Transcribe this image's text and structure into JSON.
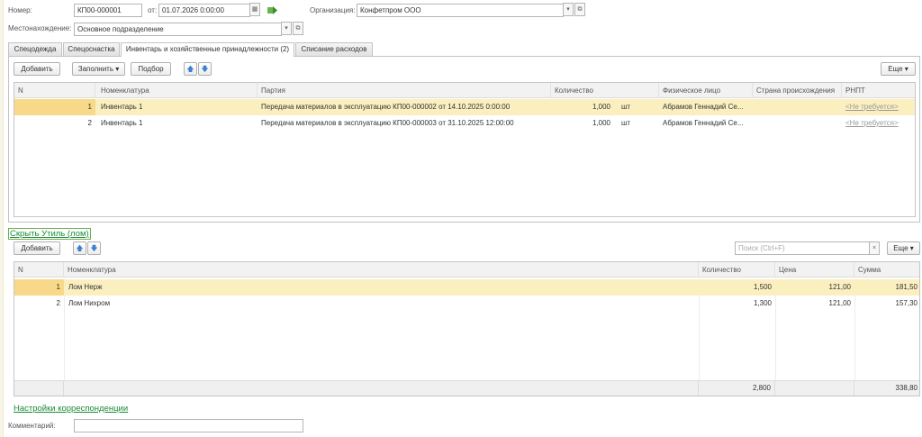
{
  "header": {
    "number_label": "Номер:",
    "number_value": "КП00-000001",
    "date_label": "от:",
    "date_value": "01.07.2026  0:00:00",
    "org_label": "Организация:",
    "org_value": "Конфетпром ООО",
    "location_label": "Местонахождение:",
    "location_value": "Основное подразделение"
  },
  "tabs": [
    {
      "label": "Спецодежда"
    },
    {
      "label": "Спецоснастка"
    },
    {
      "label": "Инвентарь и хозяйственные принадлежности (2)"
    },
    {
      "label": "Списание расходов"
    }
  ],
  "table1": {
    "toolbar": {
      "add": "Добавить",
      "fill": "Заполнить",
      "select": "Подбор",
      "more": "Еще"
    },
    "columns": [
      "N",
      "Номенклатура",
      "Партия",
      "Количество",
      "Физическое лицо",
      "Страна происхождения",
      "РНПТ"
    ],
    "rows": [
      {
        "n": "1",
        "item": "Инвентарь 1",
        "batch": "Передача материалов в эксплуатацию КП00-000002 от 14.10.2025 0:00:00",
        "qty": "1,000",
        "unit": "шт",
        "person": "Абрамов Геннадий Се...",
        "country": "",
        "rnpt": "<Не требуется>"
      },
      {
        "n": "2",
        "item": "Инвентарь 1",
        "batch": "Передача материалов в эксплуатацию КП00-000003 от 31.10.2025 12:00:00",
        "qty": "1,000",
        "unit": "шт",
        "person": "Абрамов Геннадий Се...",
        "country": "",
        "rnpt": "<Не требуется>"
      }
    ]
  },
  "hide_scrap_link": "Скрыть Утиль (лом)",
  "table2": {
    "toolbar": {
      "add": "Добавить",
      "search_placeholder": "Поиск (Ctrl+F)",
      "more": "Еще"
    },
    "columns": [
      "N",
      "Номенклатура",
      "Количество",
      "Цена",
      "Сумма"
    ],
    "rows": [
      {
        "n": "1",
        "item": "Лом Нерж",
        "qty": "1,500",
        "price": "121,00",
        "sum": "181,50"
      },
      {
        "n": "2",
        "item": "Лом Нихром",
        "qty": "1,300",
        "price": "121,00",
        "sum": "157,30"
      }
    ],
    "totals": {
      "qty": "2,800",
      "sum": "338,80"
    }
  },
  "correspondence_link": "Настройки корреспонденции",
  "comment_label": "Комментарий:",
  "comment_value": ""
}
